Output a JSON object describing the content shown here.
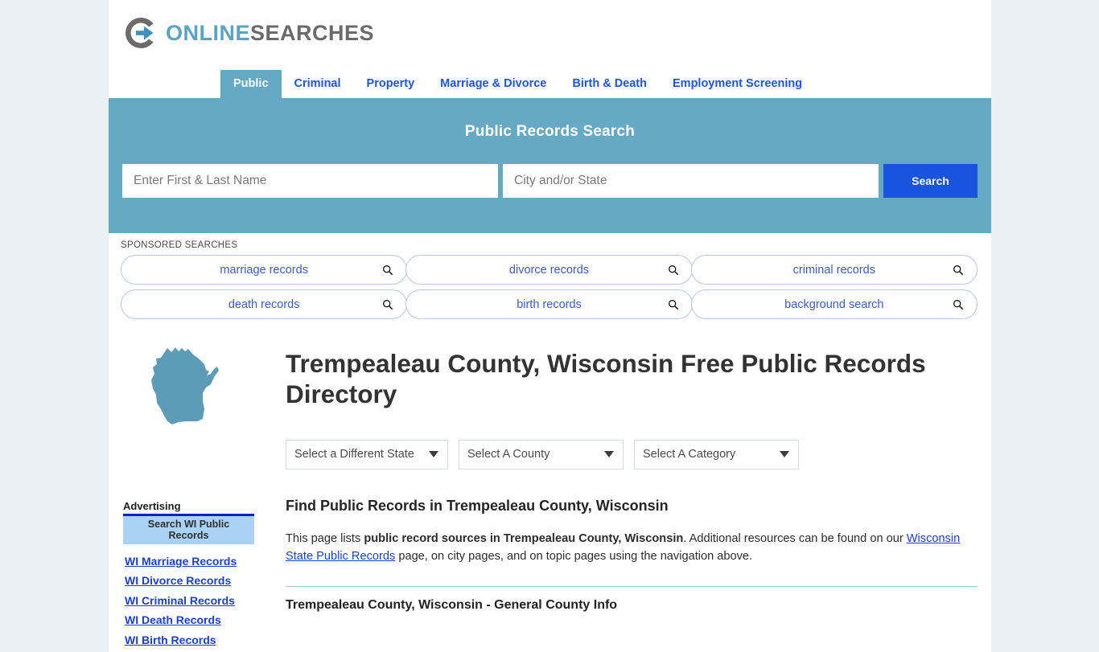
{
  "brand": {
    "logo_icon": "circle-arrow-icon",
    "name_part1": "ONLINE",
    "name_part2": "SEARCHES",
    "color_blue": "#5ba3c4",
    "color_gray": "#6b6b6b"
  },
  "nav": {
    "items": [
      {
        "label": "Public",
        "active": true
      },
      {
        "label": "Criminal",
        "active": false
      },
      {
        "label": "Property",
        "active": false
      },
      {
        "label": "Marriage & Divorce",
        "active": false
      },
      {
        "label": "Birth & Death",
        "active": false
      },
      {
        "label": "Employment Screening",
        "active": false
      }
    ]
  },
  "hero": {
    "title": "Public Records Search",
    "name_placeholder": "Enter First & Last Name",
    "name_value": "",
    "city_placeholder": "City and/or State",
    "city_value": "",
    "search_label": "Search",
    "bg_color": "#65a9c5",
    "button_color": "#1a53dd"
  },
  "sponsored": {
    "label": "SPONSORED SEARCHES",
    "row1": [
      {
        "label": "marriage records",
        "icon": "search-icon"
      },
      {
        "label": "divorce records",
        "icon": "search-icon"
      },
      {
        "label": "criminal records",
        "icon": "search-icon"
      }
    ],
    "row2": [
      {
        "label": "death records",
        "icon": "search-icon"
      },
      {
        "label": "birth records",
        "icon": "search-icon"
      },
      {
        "label": "background search",
        "icon": "search-icon"
      }
    ]
  },
  "main": {
    "state_map_icon": "wisconsin-state-outline-icon",
    "state_map_color": "#5d9cb8",
    "page_title": "Trempealeau County, Wisconsin Free Public Records Directory",
    "selects": {
      "state": "Select a Different State",
      "county": "Select A County",
      "category": "Select A Category"
    },
    "section_heading": "Find Public Records in Trempealeau County, Wisconsin",
    "paragraph": {
      "lead": "This page lists ",
      "bold": "public record sources in Trempealeau County, Wisconsin",
      "mid": ". Additional resources can be found on our ",
      "link": "Wisconsin State Public Records",
      "tail": " page, on city pages, and on topic pages using the navigation above."
    },
    "subsection_heading": "Trempealeau County, Wisconsin - General County Info"
  },
  "sidebar": {
    "advertising_label": "Advertising",
    "ad_box_label": "Search WI Public Records",
    "links": [
      "WI Marriage Records",
      "WI Divorce Records",
      "WI Criminal Records",
      "WI Death Records",
      "WI Birth Records"
    ]
  }
}
